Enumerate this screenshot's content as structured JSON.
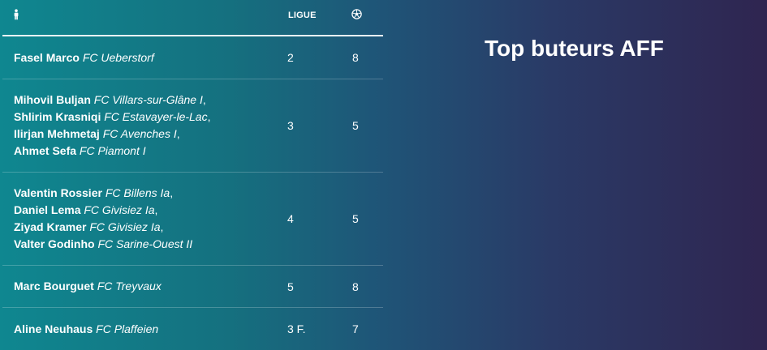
{
  "title": "Top buteurs AFF",
  "table": {
    "headers": {
      "player_icon": "person-icon",
      "league": "LIGUE",
      "goals_icon": "soccer-ball-icon"
    },
    "rows": [
      {
        "players": [
          {
            "name": "Fasel Marco",
            "club": "FC Ueberstorf",
            "sep": ""
          }
        ],
        "league": "2",
        "goals": "8"
      },
      {
        "players": [
          {
            "name": "Mihovil Buljan",
            "club": "FC Villars-sur-Glâne I",
            "sep": ","
          },
          {
            "name": "Shlirim Krasniqi",
            "club": "FC Estavayer-le-Lac",
            "sep": ","
          },
          {
            "name": "Ilirjan Mehmetaj",
            "club": "FC Avenches I",
            "sep": ","
          },
          {
            "name": "Ahmet Sefa",
            "club": "FC Piamont I",
            "sep": ""
          }
        ],
        "league": "3",
        "goals": "5"
      },
      {
        "players": [
          {
            "name": "Valentin Rossier",
            "club": "FC Billens Ia",
            "sep": ","
          },
          {
            "name": "Daniel Lema",
            "club": "FC Givisiez Ia",
            "sep": ","
          },
          {
            "name": "Ziyad Kramer",
            "club": "FC Givisiez Ia",
            "sep": ","
          },
          {
            "name": "Valter Godinho",
            "club": "FC Sarine-Ouest II",
            "sep": ""
          }
        ],
        "league": "4",
        "goals": "5"
      },
      {
        "players": [
          {
            "name": "Marc Bourguet",
            "club": "FC Treyvaux",
            "sep": ""
          }
        ],
        "league": "5",
        "goals": "8"
      },
      {
        "players": [
          {
            "name": "Aline Neuhaus",
            "club": "FC Plaffeien",
            "sep": ""
          }
        ],
        "league": "3 F.",
        "goals": "7"
      }
    ]
  }
}
